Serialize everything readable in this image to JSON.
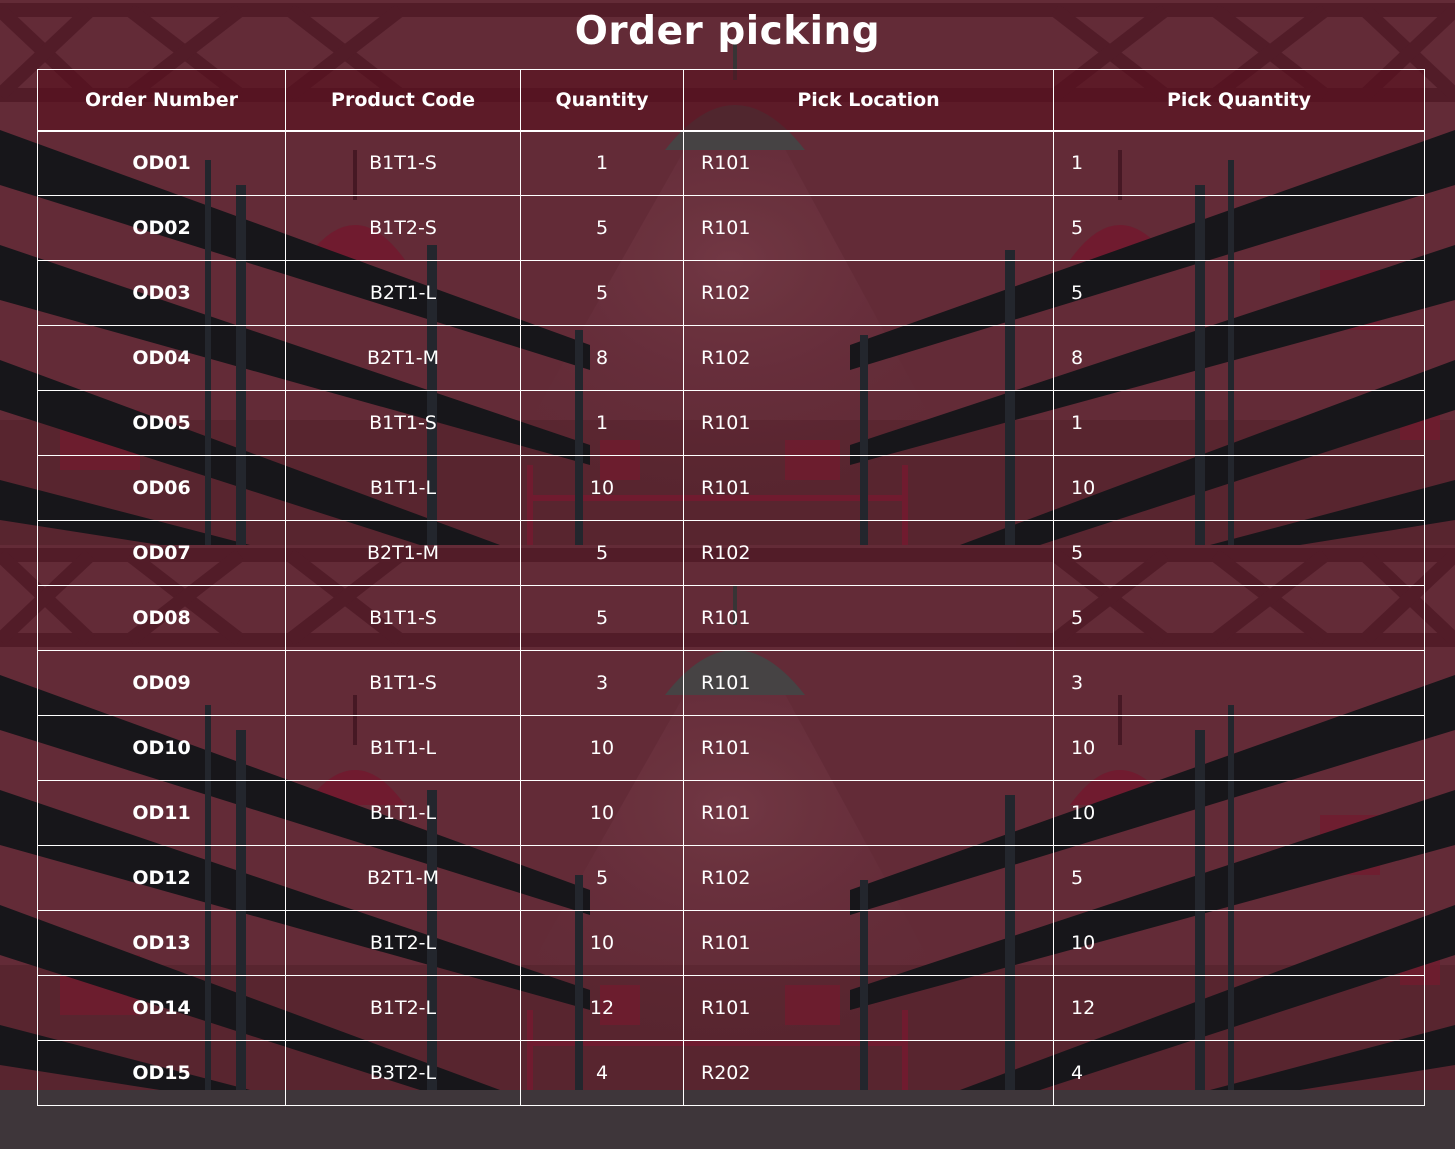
{
  "title": "Order picking",
  "colors": {
    "wall": "#6b2f3c",
    "shelf": "#15171b",
    "post": "#232a30",
    "box": "#7a1d33",
    "grid_line": "#ffffff"
  },
  "table": {
    "headers": {
      "order_number": "Order Number",
      "product_code": "Product Code",
      "quantity": "Quantity",
      "pick_location": "Pick Location",
      "pick_quantity": "Pick Quantity"
    },
    "rows": [
      {
        "order_number": "OD01",
        "product_code": "B1T1-S",
        "quantity": "1",
        "pick_location": "R101",
        "pick_quantity": "1"
      },
      {
        "order_number": "OD02",
        "product_code": "B1T2-S",
        "quantity": "5",
        "pick_location": "R101",
        "pick_quantity": "5"
      },
      {
        "order_number": "OD03",
        "product_code": "B2T1-L",
        "quantity": "5",
        "pick_location": "R102",
        "pick_quantity": "5"
      },
      {
        "order_number": "OD04",
        "product_code": "B2T1-M",
        "quantity": "8",
        "pick_location": "R102",
        "pick_quantity": "8"
      },
      {
        "order_number": "OD05",
        "product_code": "B1T1-S",
        "quantity": "1",
        "pick_location": "R101",
        "pick_quantity": "1"
      },
      {
        "order_number": "OD06",
        "product_code": "B1T1-L",
        "quantity": "10",
        "pick_location": "R101",
        "pick_quantity": "10"
      },
      {
        "order_number": "OD07",
        "product_code": "B2T1-M",
        "quantity": "5",
        "pick_location": "R102",
        "pick_quantity": "5"
      },
      {
        "order_number": "OD08",
        "product_code": "B1T1-S",
        "quantity": "5",
        "pick_location": "R101",
        "pick_quantity": "5"
      },
      {
        "order_number": "OD09",
        "product_code": "B1T1-S",
        "quantity": "3",
        "pick_location": "R101",
        "pick_quantity": "3"
      },
      {
        "order_number": "OD10",
        "product_code": "B1T1-L",
        "quantity": "10",
        "pick_location": "R101",
        "pick_quantity": "10"
      },
      {
        "order_number": "OD11",
        "product_code": "B1T1-L",
        "quantity": "10",
        "pick_location": "R101",
        "pick_quantity": "10"
      },
      {
        "order_number": "OD12",
        "product_code": "B2T1-M",
        "quantity": "5",
        "pick_location": "R102",
        "pick_quantity": "5"
      },
      {
        "order_number": "OD13",
        "product_code": "B1T2-L",
        "quantity": "10",
        "pick_location": "R101",
        "pick_quantity": "10"
      },
      {
        "order_number": "OD14",
        "product_code": "B1T2-L",
        "quantity": "12",
        "pick_location": "R101",
        "pick_quantity": "12"
      },
      {
        "order_number": "OD15",
        "product_code": "B3T2-L",
        "quantity": "4",
        "pick_location": "R202",
        "pick_quantity": "4"
      }
    ]
  }
}
